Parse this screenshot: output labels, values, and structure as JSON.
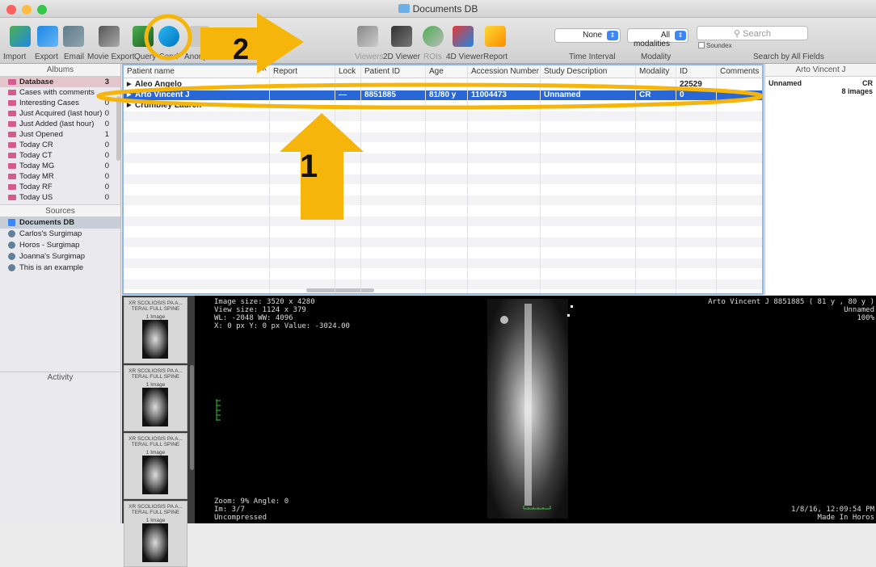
{
  "window": {
    "title": "Documents DB"
  },
  "toolbar": {
    "left_labels": [
      "Import",
      "Export",
      "Email",
      "Movie Export",
      "Query",
      "Send",
      "Anonymize"
    ],
    "viewer_labels": [
      "Viewers",
      "2D Viewer",
      "ROIs",
      "4D Viewer",
      "Report"
    ],
    "time_interval": {
      "value": "None",
      "label": "Time Interval"
    },
    "modality": {
      "value": "All modalities",
      "label": "Modality"
    },
    "search": {
      "placeholder": "Search",
      "soundex": "Soundex",
      "label": "Search by All Fields"
    }
  },
  "albums": {
    "header": "Albums",
    "items": [
      {
        "label": "Database",
        "count": "3"
      },
      {
        "label": "Cases with comments",
        "count": ""
      },
      {
        "label": "Interesting Cases",
        "count": "0"
      },
      {
        "label": "Just Acquired (last hour)",
        "count": "0"
      },
      {
        "label": "Just Added (last hour)",
        "count": "0"
      },
      {
        "label": "Just Opened",
        "count": "1"
      },
      {
        "label": "Today CR",
        "count": "0"
      },
      {
        "label": "Today CT",
        "count": "0"
      },
      {
        "label": "Today MG",
        "count": "0"
      },
      {
        "label": "Today MR",
        "count": "0"
      },
      {
        "label": "Today RF",
        "count": "0"
      },
      {
        "label": "Today US",
        "count": "0"
      }
    ]
  },
  "sources": {
    "header": "Sources",
    "items": [
      "Documents DB",
      "Carlos's Surgimap",
      "Horos - Surgimap",
      "Joanna's Surgimap",
      "This is an example"
    ]
  },
  "activity": {
    "label": "Activity"
  },
  "table": {
    "columns": [
      "Patient name",
      "Report",
      "Lock",
      "Patient ID",
      "Age",
      "Accession Number",
      "Study Description",
      "Modality",
      "ID",
      "Comments"
    ],
    "rows": [
      {
        "name": "Aleo Angelo",
        "report": "",
        "lock": "",
        "pid": "",
        "age": "",
        "acc": "",
        "desc": "",
        "modality": "",
        "id": "22529",
        "comments": ""
      },
      {
        "name": "Arto Vincent J",
        "report": "",
        "lock": "—",
        "pid": "8851885",
        "age": "81/80 y",
        "acc": "11004473",
        "desc": "Unnamed",
        "modality": "CR",
        "id": "0",
        "comments": ""
      },
      {
        "name": "Crumbley Lauren",
        "report": "",
        "lock": "",
        "pid": "",
        "age": "",
        "acc": "",
        "desc": "",
        "modality": "",
        "id": "",
        "comments": ""
      }
    ]
  },
  "right_panel": {
    "title": "Arto Vincent J",
    "name": "Unnamed",
    "modality": "CR",
    "count": "8 images"
  },
  "series": [
    {
      "title": "XR SCOLIOSIS PA A... TERAL FULL SPINE",
      "images": "1 Image"
    },
    {
      "title": "XR SCOLIOSIS PA A... TERAL FULL SPINE",
      "images": "1 Image"
    },
    {
      "title": "XR SCOLIOSIS PA A... TERAL FULL SPINE",
      "images": "1 Image"
    },
    {
      "title": "XR SCOLIOSIS PA A... TERAL FULL SPINE",
      "images": "1 Image"
    }
  ],
  "viewer": {
    "info": [
      "Image size: 3520 x 4280",
      "View size: 1124 x 379",
      "WL: -2048 WW: 4096",
      "X: 0 px Y: 0 px Value: -3024.00"
    ],
    "patient": "Arto Vincent J 8851885 ( 81 y , 80 y )",
    "study": "Unnamed",
    "zoom_pct": "100%",
    "bottom_left": [
      "Zoom: 9% Angle: 0",
      "Im: 3/7",
      "Uncompressed"
    ],
    "bottom_right": [
      "1/8/16, 12:09:54 PM",
      "Made In Horos"
    ]
  },
  "annotations": {
    "label1": "1",
    "label2": "2"
  },
  "colors": {
    "highlight": "#f5b50a",
    "selection": "#2a67d6"
  }
}
